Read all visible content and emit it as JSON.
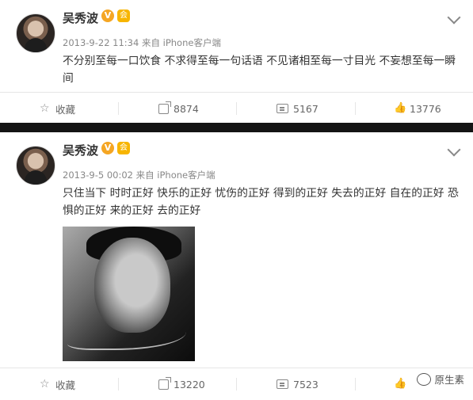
{
  "posts": [
    {
      "username": "吴秀波",
      "verified_badge": "V",
      "member_badge": "会",
      "meta": "2013-9-22 11:34 来自 iPhone客户端",
      "text": "不分别至每一口饮食 不求得至每一句话语 不见诸相至每一寸目光 不妄想至每一瞬间",
      "actions": {
        "favorite": "收藏",
        "repost": "8874",
        "comment": "5167",
        "like": "13776"
      }
    },
    {
      "username": "吴秀波",
      "verified_badge": "V",
      "member_badge": "会",
      "meta": "2013-9-5 00:02 来自 iPhone客户端",
      "text": "只住当下 时时正好 快乐的正好 忧伤的正好 得到的正好 失去的正好 自在的正好 恐惧的正好 来的正好 去的正好",
      "actions": {
        "favorite": "收藏",
        "repost": "13220",
        "comment": "7523",
        "like": ""
      }
    }
  ],
  "watermark": "原生素",
  "colors": {
    "verified": "#f5a623",
    "divider": "#141414"
  }
}
